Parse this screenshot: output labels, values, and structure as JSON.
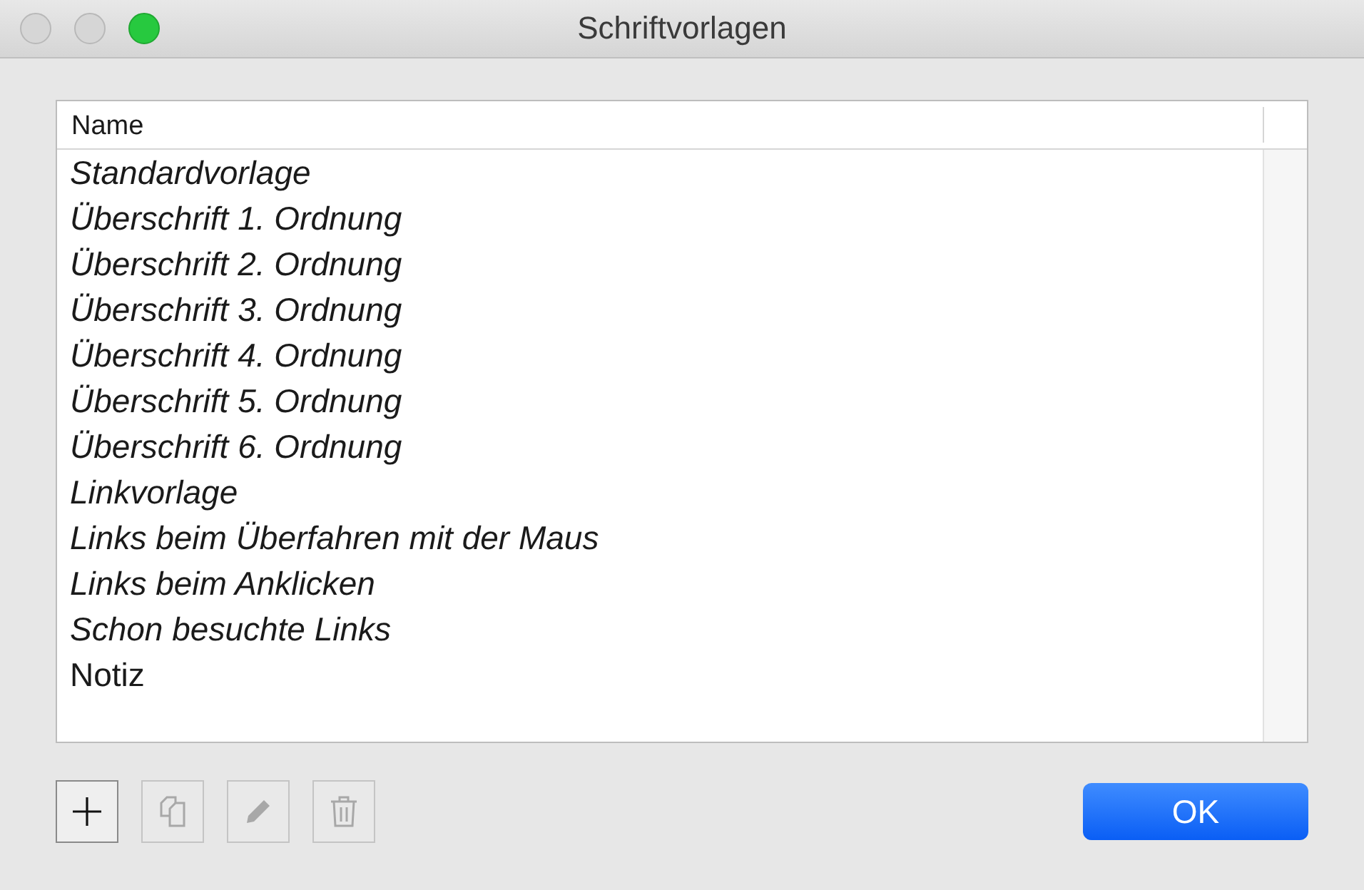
{
  "window": {
    "title": "Schriftvorlagen",
    "controls": [
      {
        "kind": "close",
        "enabled": false
      },
      {
        "kind": "minimize",
        "enabled": false
      },
      {
        "kind": "zoom",
        "enabled": true
      }
    ]
  },
  "table": {
    "columns": [
      "Name"
    ],
    "rows": [
      {
        "name": "Standardvorlage",
        "italic": true
      },
      {
        "name": "Überschrift 1. Ordnung",
        "italic": true
      },
      {
        "name": "Überschrift 2. Ordnung",
        "italic": true
      },
      {
        "name": "Überschrift 3. Ordnung",
        "italic": true
      },
      {
        "name": "Überschrift 4. Ordnung",
        "italic": true
      },
      {
        "name": "Überschrift 5. Ordnung",
        "italic": true
      },
      {
        "name": "Überschrift 6. Ordnung",
        "italic": true
      },
      {
        "name": "Linkvorlage",
        "italic": true
      },
      {
        "name": "Links beim Überfahren mit der Maus",
        "italic": true
      },
      {
        "name": "Links beim Anklicken",
        "italic": true
      },
      {
        "name": "Schon besuchte Links",
        "italic": true
      },
      {
        "name": "Notiz",
        "italic": false
      }
    ]
  },
  "toolbar": [
    {
      "kind": "add",
      "disabled": false
    },
    {
      "kind": "duplicate",
      "disabled": true
    },
    {
      "kind": "edit",
      "disabled": true
    },
    {
      "kind": "delete",
      "disabled": true
    }
  ],
  "buttons": [
    {
      "label": "OK",
      "default": true
    }
  ]
}
